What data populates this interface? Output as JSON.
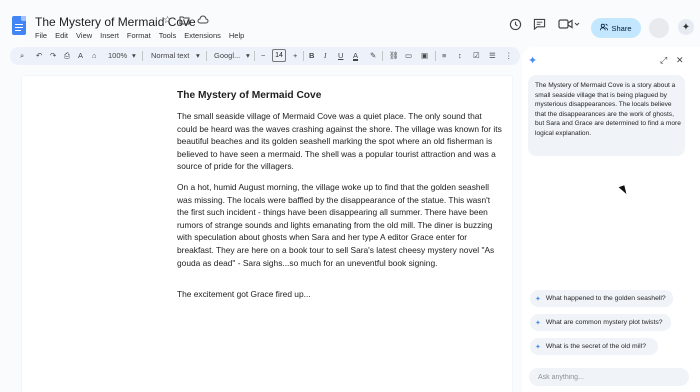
{
  "doc": {
    "title": "The Mystery of Mermaid Cove",
    "menu": [
      "File",
      "Edit",
      "View",
      "Insert",
      "Format",
      "Tools",
      "Extensions",
      "Help"
    ]
  },
  "header": {
    "share_label": "Share"
  },
  "toolbar": {
    "zoom": "100%",
    "style": "Normal text",
    "font": "Googl...",
    "font_size": "14"
  },
  "document": {
    "heading": "The Mystery of Mermaid Cove",
    "paragraphs": [
      "The small seaside village of Mermaid Cove was a quiet place. The only sound that could be heard was the waves crashing against the shore. The village was known for its beautiful beaches and its golden seashell marking the spot where an old fisherman is believed to have seen a mermaid. The shell was a popular tourist attraction and was a source of pride for the villagers.",
      "On a hot, humid August morning, the village woke up to find that the golden seashell was missing. The locals were baffled by the disappearance of the statue. This wasn't the first such incident - things have been disappearing all summer. There have been rumors of strange sounds and lights emanating from the old mill. The diner is buzzing with speculation about ghosts when Sara and her type A editor Grace enter for breakfast. They are here on a book tour to sell Sara's latest cheesy mystery novel \"As gouda as dead\" - Sara sighs...so much for an uneventful book signing.",
      "The excitement got Grace fired up..."
    ]
  },
  "panel": {
    "summary": "The Mystery of Mermaid Cove is a story about a small seaside village that is being plagued by mysterious disappearances. The locals believe that the disappearances are the work of ghosts, but Sara and Grace are determined to find a more logical explanation.",
    "suggestions": [
      "What happened to the golden seashell?",
      "What are common mystery plot twists?",
      "What is the secret of the old mill?"
    ],
    "input_placeholder": "Ask anything..."
  },
  "colors": {
    "share_bg": "#c2e7ff",
    "gemini_accent": "#4a8cf7",
    "doc_icon": "#4285f4"
  },
  "icons": {
    "doc": "google-docs-icon",
    "star": "star-icon",
    "move": "move-to-folder-icon",
    "cloud": "cloud-status-icon",
    "history": "history-icon",
    "comments": "comments-icon",
    "meet": "video-call-icon",
    "lock": "lock-icon",
    "gemini": "gemini-sparkle-icon"
  }
}
